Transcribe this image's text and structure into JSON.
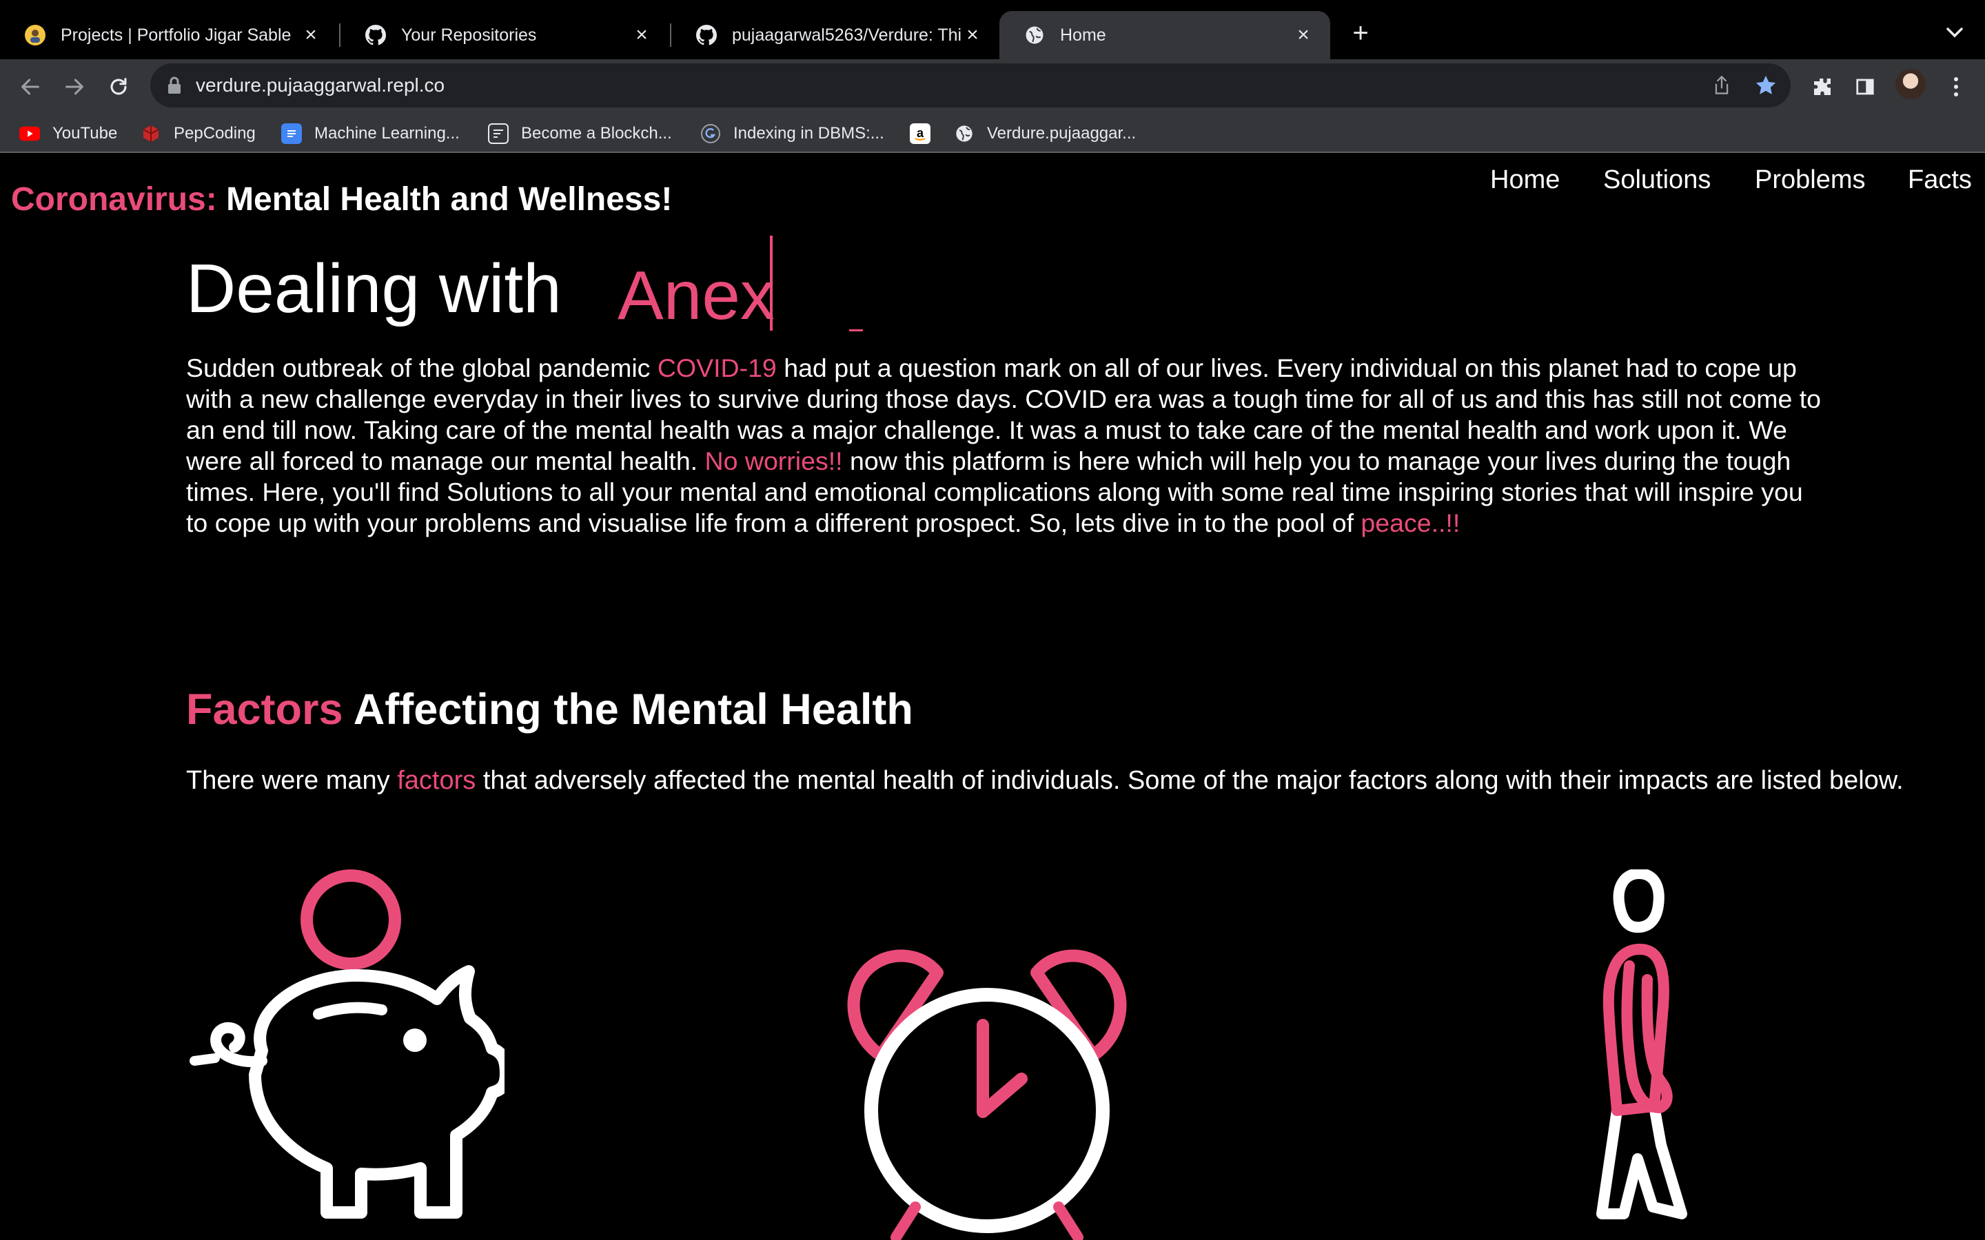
{
  "browser": {
    "tabs": [
      {
        "title": "Projects | Portfolio Jigar Sable",
        "icon": "profile-avatar-icon"
      },
      {
        "title": "Your Repositories",
        "icon": "github-icon"
      },
      {
        "title": "pujaagarwal5263/Verdure: This",
        "icon": "github-icon"
      },
      {
        "title": "Home",
        "icon": "globe-icon"
      }
    ],
    "url": "verdure.pujaaggarwal.repl.co",
    "bookmarks": [
      {
        "label": "YouTube",
        "icon": "youtube-icon"
      },
      {
        "label": "PepCoding",
        "icon": "pepcoding-icon"
      },
      {
        "label": "Machine Learning...",
        "icon": "google-docs-icon"
      },
      {
        "label": "Become a Blockch...",
        "icon": "blockchain-icon"
      },
      {
        "label": "Indexing in DBMS:...",
        "icon": "geeks-icon"
      },
      {
        "label": "",
        "icon": "amazon-icon"
      },
      {
        "label": "Verdure.pujaaggar...",
        "icon": "globe-icon"
      }
    ]
  },
  "site": {
    "brand_accent": "Coronavirus:",
    "brand_rest": "Mental Health and Wellness!",
    "nav": [
      "Home",
      "Solutions",
      "Problems",
      "Facts"
    ]
  },
  "hero": {
    "lead": "Dealing with",
    "typed_word": "Anex"
  },
  "intro": {
    "p1": "Sudden outbreak of the global pandemic ",
    "hl1": "COVID-19",
    "p2": " had put a question mark on all of our lives. Every individual on this planet had to cope up with a new challenge everyday in their lives to survive during those days. COVID era was a tough time for all of us and this has still not come to an end till now. Taking care of the mental health was a major challenge. It was a must to take care of the mental health and work upon it. We were all forced to manage our mental health. ",
    "hl2": "No worries!!",
    "p3": " now this platform is here which will help you to manage your lives during the tough times. Here, you'll find Solutions to all your mental and emotional complications along with some real time inspiring stories that will inspire you to cope up with your problems and visualise life from a different prospect. So, lets dive in to the pool of ",
    "hl3": "peace..!!"
  },
  "factors": {
    "title_accent": "Factors",
    "title_rest": "Affecting the Mental Health",
    "desc_a": "There were many ",
    "desc_hl": "factors",
    "desc_b": " that adversely affected the mental health of individuals. Some of the major factors along with their impacts are listed below.",
    "illustrations": [
      "piggy-bank-icon",
      "alarm-clock-icon",
      "walking-person-icon"
    ]
  },
  "colors": {
    "accent": "#ea4c79",
    "background": "#000000",
    "text": "#ffffff"
  }
}
